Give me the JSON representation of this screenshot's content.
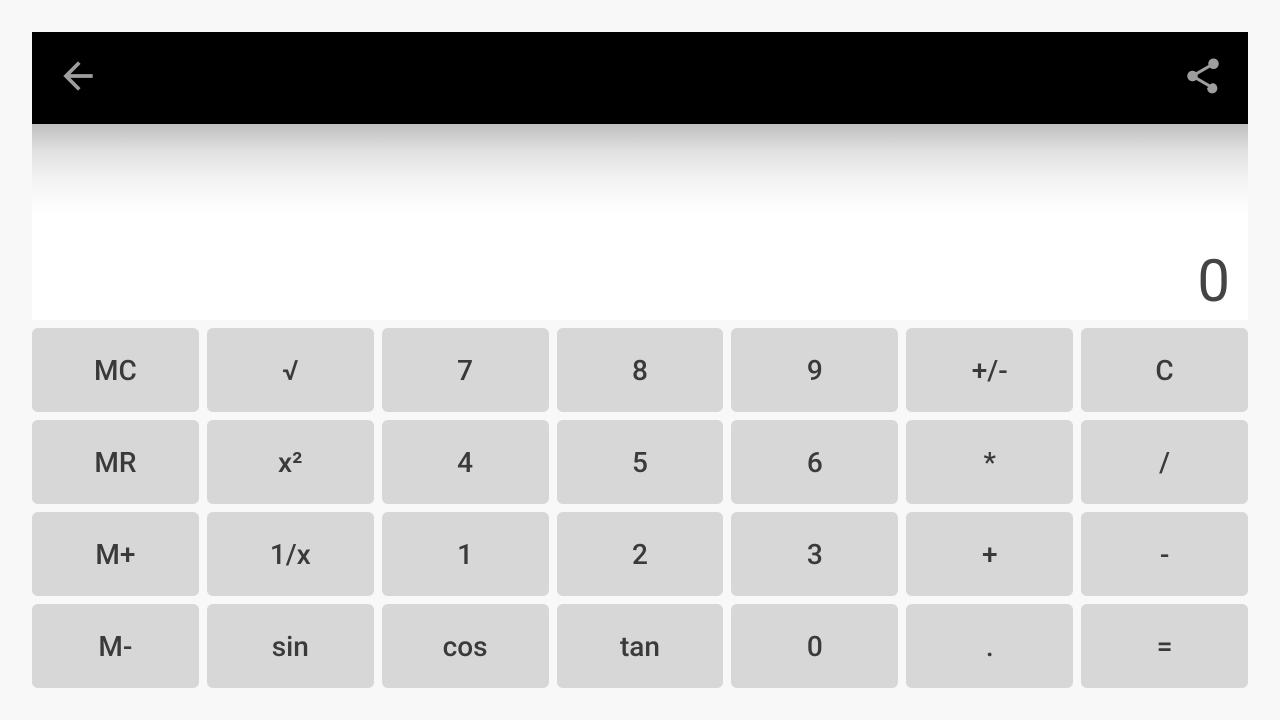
{
  "display": {
    "value": "0"
  },
  "keypad": {
    "rows": [
      [
        "MC",
        "√",
        "7",
        "8",
        "9",
        "+/-",
        "C"
      ],
      [
        "MR",
        "x²",
        "4",
        "5",
        "6",
        "*",
        "/"
      ],
      [
        "M+",
        "1/x",
        "1",
        "2",
        "3",
        "+",
        "-"
      ],
      [
        "M-",
        "sin",
        "cos",
        "tan",
        "0",
        ".",
        "="
      ]
    ]
  },
  "key_names": {
    "MC": "memory-clear-button",
    "MR": "memory-recall-button",
    "M+": "memory-add-button",
    "M-": "memory-subtract-button",
    "√": "sqrt-button",
    "x²": "square-button",
    "1/x": "reciprocal-button",
    "sin": "sin-button",
    "cos": "cos-button",
    "tan": "tan-button",
    "+/-": "negate-button",
    "C": "clear-button",
    "*": "multiply-button",
    "/": "divide-button",
    "+": "add-button",
    "-": "subtract-button",
    ".": "decimal-button",
    "=": "equals-button",
    "0": "digit-0-button",
    "1": "digit-1-button",
    "2": "digit-2-button",
    "3": "digit-3-button",
    "4": "digit-4-button",
    "5": "digit-5-button",
    "6": "digit-6-button",
    "7": "digit-7-button",
    "8": "digit-8-button",
    "9": "digit-9-button"
  }
}
